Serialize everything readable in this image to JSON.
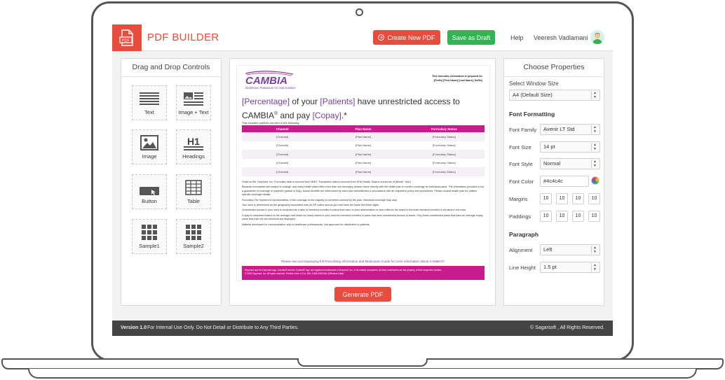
{
  "header": {
    "app_title": "PDF BUILDER",
    "new_pdf_label": "Create New PDF",
    "draft_label": "Save as Draft",
    "help_label": "Help",
    "user_name": "Veeresh Vadlamani",
    "logo_text": "PDF"
  },
  "left_panel": {
    "title": "Drag and Drop Controls",
    "controls": [
      {
        "label": "Text",
        "icon": "text-icon"
      },
      {
        "label": "Image + Text",
        "icon": "image-text-icon"
      },
      {
        "label": "Image",
        "icon": "image-icon"
      },
      {
        "label": "Headings",
        "icon": "heading-icon",
        "glyph": "H1"
      },
      {
        "label": "Button",
        "icon": "button-icon"
      },
      {
        "label": "Table",
        "icon": "table-icon"
      },
      {
        "label": "Sample1",
        "icon": "grid-icon"
      },
      {
        "label": "Sample2",
        "icon": "grid-icon"
      }
    ]
  },
  "document": {
    "brand": "CAMBIA",
    "brand_tagline": "Diclofenac Potassium for Oral Solution",
    "prepared_for": "This formulary information is prepared for",
    "prepared_names": "[Prefix] [First Name] [Last Name], Suffix]",
    "headline_prefix1": "[Percentage]",
    "headline_mid1": " of your ",
    "headline_prefix2": "[Patients]",
    "headline_mid2": " have unrestricted access to",
    "headline_line2a": "CAMBIA",
    "headline_reg": "®",
    "headline_line2b": " and pay ",
    "headline_copay": "[Copay]",
    "headline_end": ".*",
    "intro": "This includes patients enrolled in the following:",
    "table": {
      "headers": [
        "Channel",
        "Plan Name",
        "Formulary Status"
      ],
      "rows": [
        [
          "[Channel]",
          "[Plan Name]",
          "[Formulary Status]"
        ],
        [
          "[Channel]",
          "[Plan Name]",
          "[Formulary Status]"
        ],
        [
          "[Channel]",
          "[Plan Name]",
          "[Formulary Status]"
        ],
        [
          "[Channel]",
          "[Plan Name]",
          "[Formulary Status]"
        ],
        [
          "[Channel]",
          "[Plan Name]",
          "[Formulary Status]"
        ]
      ]
    },
    "notes": [
      "*Data on file. Deponed, Inc. Formulary data is sourced from MMIT. Transaction data is sourced from SHA Health. Data is current as of [Month, Year].",
      "Because formularies are subject to change, and many health plans offer more than one formulary, please check directly with the health plan to confirm coverage for individual plans. The information provided is not a guarantee of coverage or payment (partial or fully). Actual benefits are determined by each plan administrator in accordance with its respective policy and procedures. Please consult health plan for patient specific coverage details.",
      "Formulary Tier reported is representative of the coverage of the majority of members covered by the plan. Individual coverage may vary.",
      "Your area is determined as the geography associated with all ZIP codes around you that have the same first three digits.",
      "Unrestricted access in your area is computed as a ratio of members enrolled in plans that have no prior authorization or step edits for the brand to the total members enrolled in all plans in the area.",
      "Copay is computed based on the average cost share for brand claims in your area for members enrolled in plans that have unrestricted access to brand. Only those unrestricted plans that have an average copay value less than the set threshold are displayed.",
      "Material developed for communication only to healthcare professionals. Not approved for distribution to patients."
    ],
    "pi_link": "Please see accompanying full Prescribing Information and Medication Guide for more information about CAMBIA®.",
    "footer_line1": "Deponed and the Deponed logo, Cambia® and the Cambia® logo are registered trademarks of Deponed, Inc. or its related companies. All other trademarks are the property of their respective owners.",
    "footer_line2": "© 2016 Deponed, Inc. All rights reserved. Printed in the U.S.A. DEL-CAM-0028 Rev. [Effective Date]"
  },
  "generate_label": "Generate PDF",
  "right_panel": {
    "title": "Choose Properties",
    "window_size_label": "Select Window Size",
    "window_size_value": "A4 (Default Size)",
    "font_formatting": "Font Formatting",
    "font_family_label": "Font Family",
    "font_family_value": "Avenir LT Std",
    "font_size_label": "Font Size",
    "font_size_value": "14 pt",
    "font_style_label": "Font Style",
    "font_style_value": "Normal",
    "font_color_label": "Font Color",
    "font_color_value": "#4c4c4c",
    "margins_label": "Margins",
    "margins": [
      "10",
      "10",
      "10",
      "10"
    ],
    "paddings_label": "Paddings",
    "paddings": [
      "10",
      "10",
      "10",
      "10"
    ],
    "paragraph": "Paragraph",
    "alignment_label": "Alignment",
    "alignment_value": "Left",
    "line_height_label": "Line Height",
    "line_height_value": "1.5 pt"
  },
  "footer": {
    "version": "Version 1.0",
    "note": "For Internal Use Only. Do Not Detail or Distribute to Any Third Parties.",
    "copyright": "© Sagarsoft , All Rights Reserved."
  },
  "colors": {
    "accent": "#e84c3d",
    "success": "#2fb552",
    "magenta": "#c81c8c",
    "purple": "#7a3fa0"
  }
}
